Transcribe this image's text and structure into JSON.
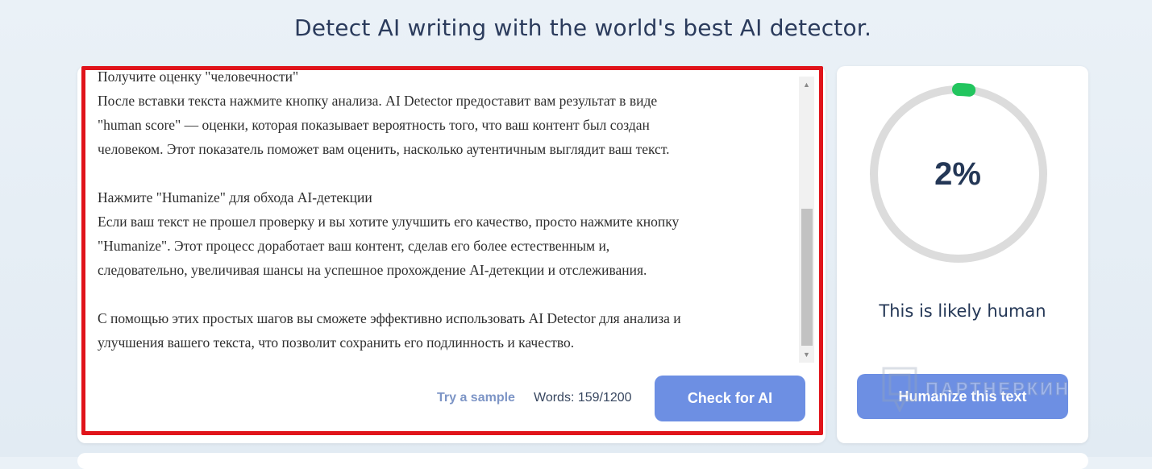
{
  "header": {
    "headline": "Detect AI writing with the world's best AI detector."
  },
  "editor": {
    "paragraphs": [
      "Получите оценку \"человечности\"",
      "После вставки текста нажмите кнопку анализа. AI Detector предоставит вам результат в виде",
      "\"human score\" — оценки, которая показывает вероятность того, что ваш контент был создан",
      "человеком. Этот показатель поможет вам оценить, насколько аутентичным выглядит ваш текст.",
      "",
      "Нажмите \"Humanize\" для обхода AI-детекции",
      "Если ваш текст не прошел проверку и вы хотите улучшить его качество, просто нажмите кнопку",
      "\"Humanize\". Этот процесс доработает ваш контент, сделав его более естественным и,",
      "следовательно, увеличивая шансы на успешное прохождение AI-детекции и отслеживания.",
      "",
      "С помощью этих простых шагов вы сможете эффективно использовать AI Detector для анализа и",
      "улучшения вашего текста, что позволит сохранить его подлинность и качество."
    ],
    "try_sample": "Try a sample",
    "word_count": "Words: 159/1200",
    "check_button": "Check for AI",
    "highlight_color": "#e0141b"
  },
  "result": {
    "score_text": "2%",
    "score_fraction": 0.02,
    "verdict": "This is likely human",
    "humanize_button": "Humanize this text",
    "gauge_color": "#22c55e",
    "track_color": "#dcdcdc"
  },
  "watermark": {
    "text": "ПАРТНЕРКИН"
  }
}
